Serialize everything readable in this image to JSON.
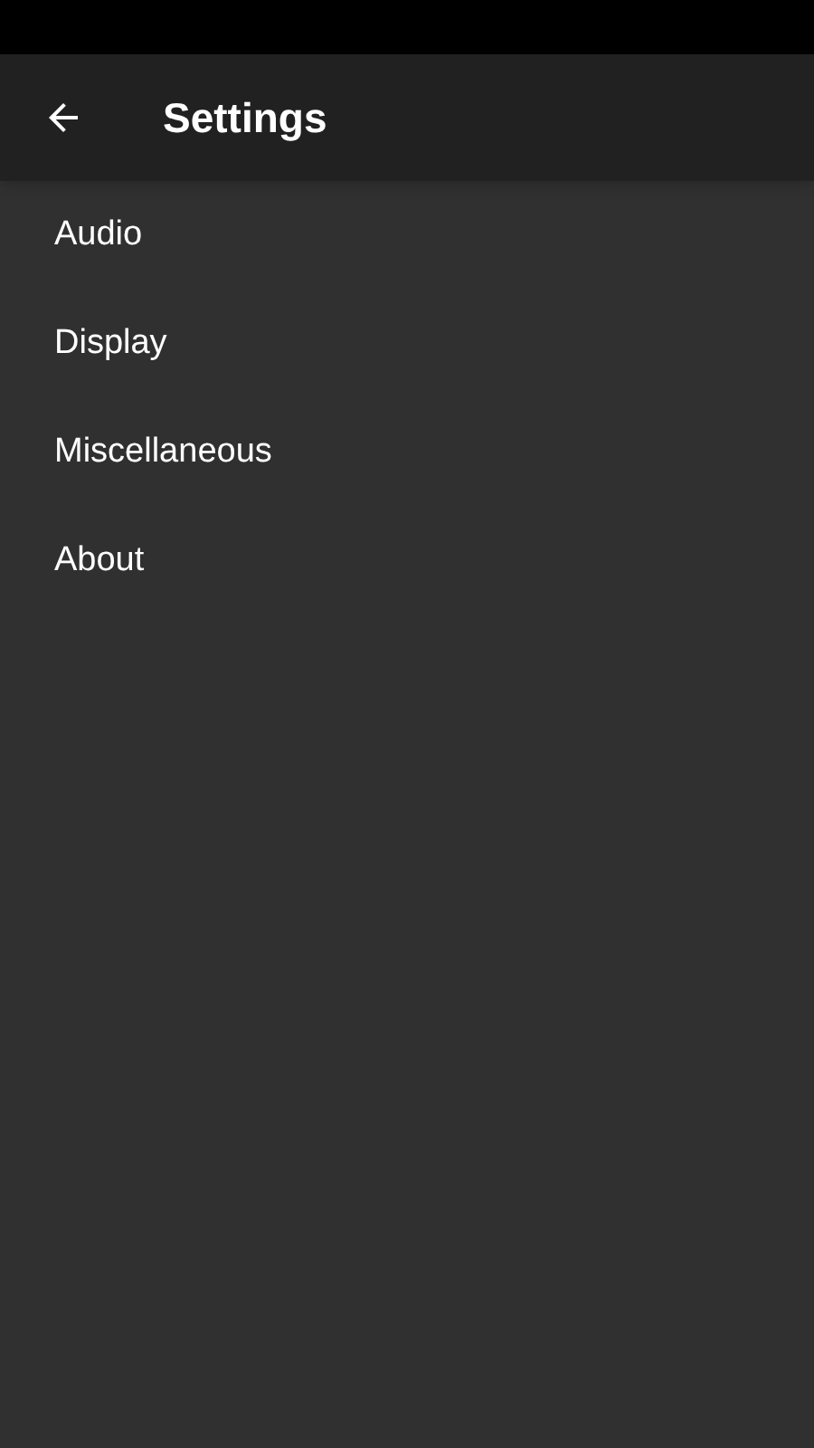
{
  "app_bar": {
    "title": "Settings"
  },
  "items": [
    {
      "label": "Audio"
    },
    {
      "label": "Display"
    },
    {
      "label": "Miscellaneous"
    },
    {
      "label": "About"
    }
  ]
}
